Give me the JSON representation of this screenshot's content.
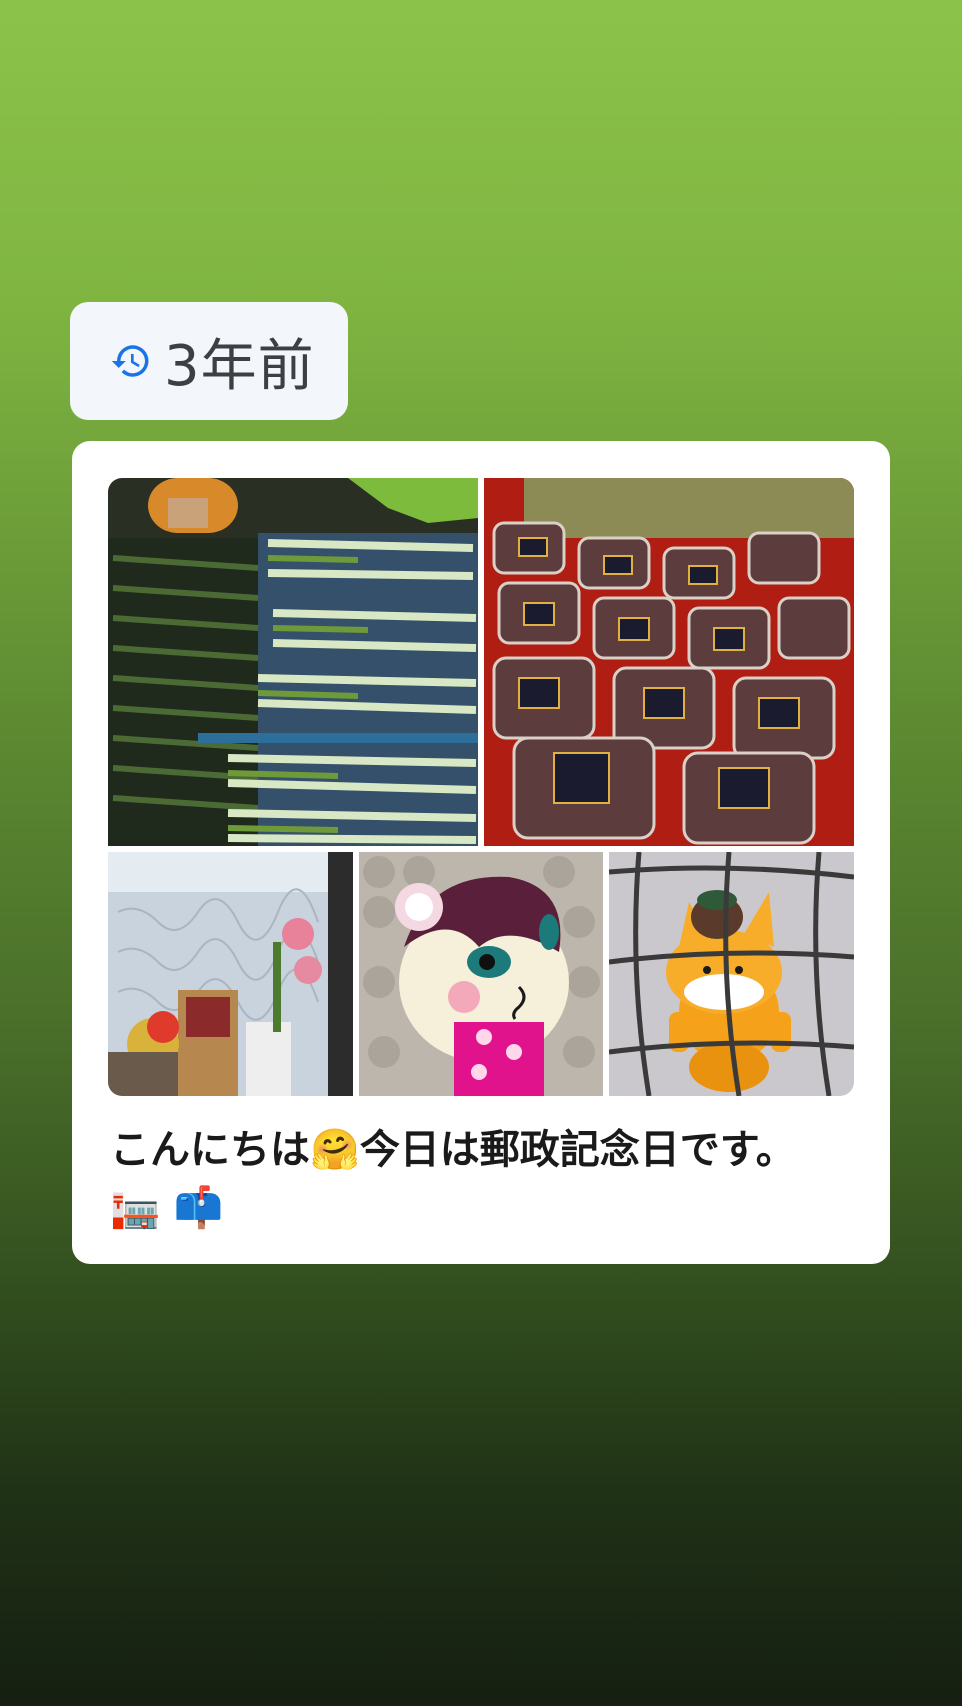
{
  "memory": {
    "icon": "history-icon",
    "label": "3年前"
  },
  "post": {
    "text_line1_a": "こんにちは",
    "emoji_hug": "🤗",
    "text_line1_b": "今日は郵政記念日です。",
    "emoji_post_office": "🏣",
    "emoji_mailbox": "📫"
  },
  "photos": [
    {
      "name": "photo-green-onions"
    },
    {
      "name": "photo-grape-packs"
    },
    {
      "name": "photo-window-shrine"
    },
    {
      "name": "photo-game-character"
    },
    {
      "name": "photo-fox-figure"
    }
  ],
  "colors": {
    "accent_icon": "#1a73e8",
    "card_bg": "#ffffff",
    "badge_bg": "#f3f6fa"
  }
}
